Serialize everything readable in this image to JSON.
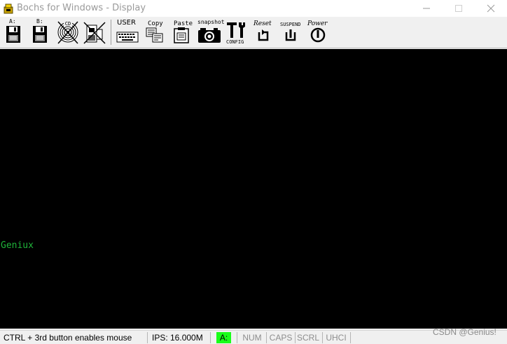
{
  "window": {
    "title": "Bochs for Windows - Display"
  },
  "toolbar": {
    "floppy_a": "A:",
    "floppy_b": "B:",
    "cdrom": "CD",
    "user": "USER",
    "copy": "Copy",
    "paste": "Paste",
    "snapshot": "snapshot",
    "config": "CONFIG",
    "reset": "Reset",
    "suspend": "SUSPEND",
    "power": "Power"
  },
  "screen": {
    "text": "Geniux",
    "text_color": "#1fb43a",
    "background": "#000000"
  },
  "statusbar": {
    "mouse_hint": "CTRL + 3rd button enables mouse",
    "ips": "IPS: 16.000M",
    "drive_a": "A:",
    "num": "NUM",
    "caps": "CAPS",
    "scrl": "SCRL",
    "uhci": "UHCI",
    "active_led_color": "#19ff19"
  },
  "watermark": "CSDN @Genius!"
}
